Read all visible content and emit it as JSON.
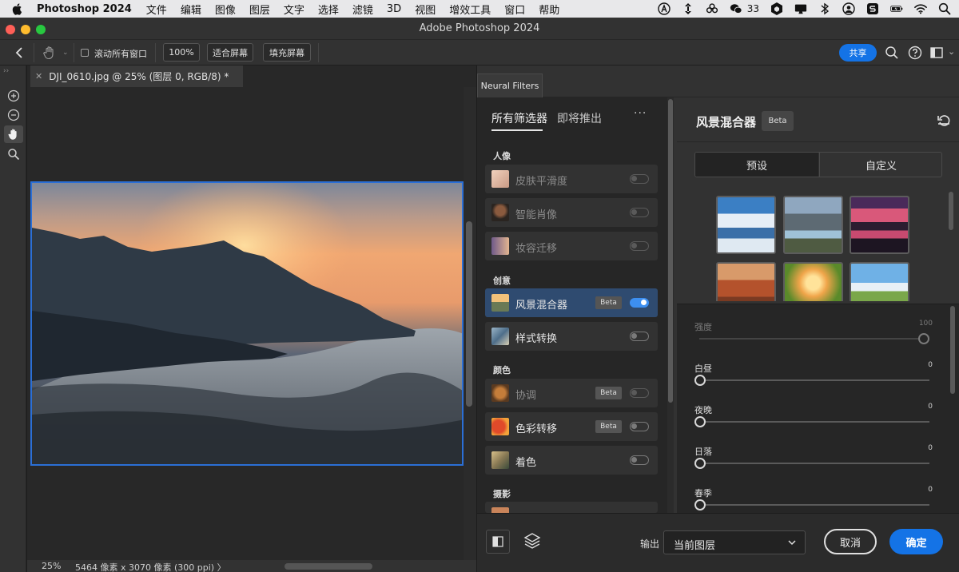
{
  "menubar": {
    "app_name": "Photoshop 2024",
    "menus": [
      "文件",
      "编辑",
      "图像",
      "图层",
      "文字",
      "选择",
      "滤镜",
      "3D",
      "视图",
      "增效工具",
      "窗口",
      "帮助"
    ],
    "wechat_count": "33"
  },
  "window": {
    "title": "Adobe Photoshop 2024"
  },
  "options": {
    "scroll_all_label": "滚动所有窗口",
    "zoom_100": "100%",
    "fit_screen": "适合屏幕",
    "fill_screen": "填充屏幕",
    "share": "共享"
  },
  "document": {
    "tab_title": "DJI_0610.jpg @ 25% (图层 0, RGB/8) *",
    "zoom": "25%",
    "info": "5464 像素 x 3070 像素 (300 ppi)",
    "info_arrow": "〉"
  },
  "neural": {
    "panel_tab": "Neural Filters",
    "tab_all": "所有筛选器",
    "tab_coming": "即将推出",
    "more": "···",
    "categories": {
      "portrait": "人像",
      "creative": "创意",
      "color": "颜色",
      "photo": "摄影"
    },
    "items": {
      "skin": "皮肤平滑度",
      "smart_portrait": "智能肖像",
      "makeup": "妆容迁移",
      "landscape": "风景混合器",
      "style": "样式转换",
      "harmonize": "协调",
      "color_transfer": "色彩转移",
      "colorize": "着色"
    },
    "beta": "Beta",
    "detail": {
      "title": "风景混合器",
      "badge": "Beta",
      "tab_preset": "预设",
      "tab_custom": "自定义",
      "sliders": [
        {
          "name": "强度",
          "value": "100"
        },
        {
          "name": "白昼",
          "value": "0"
        },
        {
          "name": "夜晚",
          "value": "0"
        },
        {
          "name": "日落",
          "value": "0"
        },
        {
          "name": "春季",
          "value": "0"
        }
      ]
    },
    "footer": {
      "output_label": "输出",
      "output_value": "当前图层",
      "cancel": "取消",
      "ok": "确定"
    }
  },
  "colors": {
    "accent": "#1473e6",
    "selection": "#2f4b70",
    "panel": "#323232"
  }
}
